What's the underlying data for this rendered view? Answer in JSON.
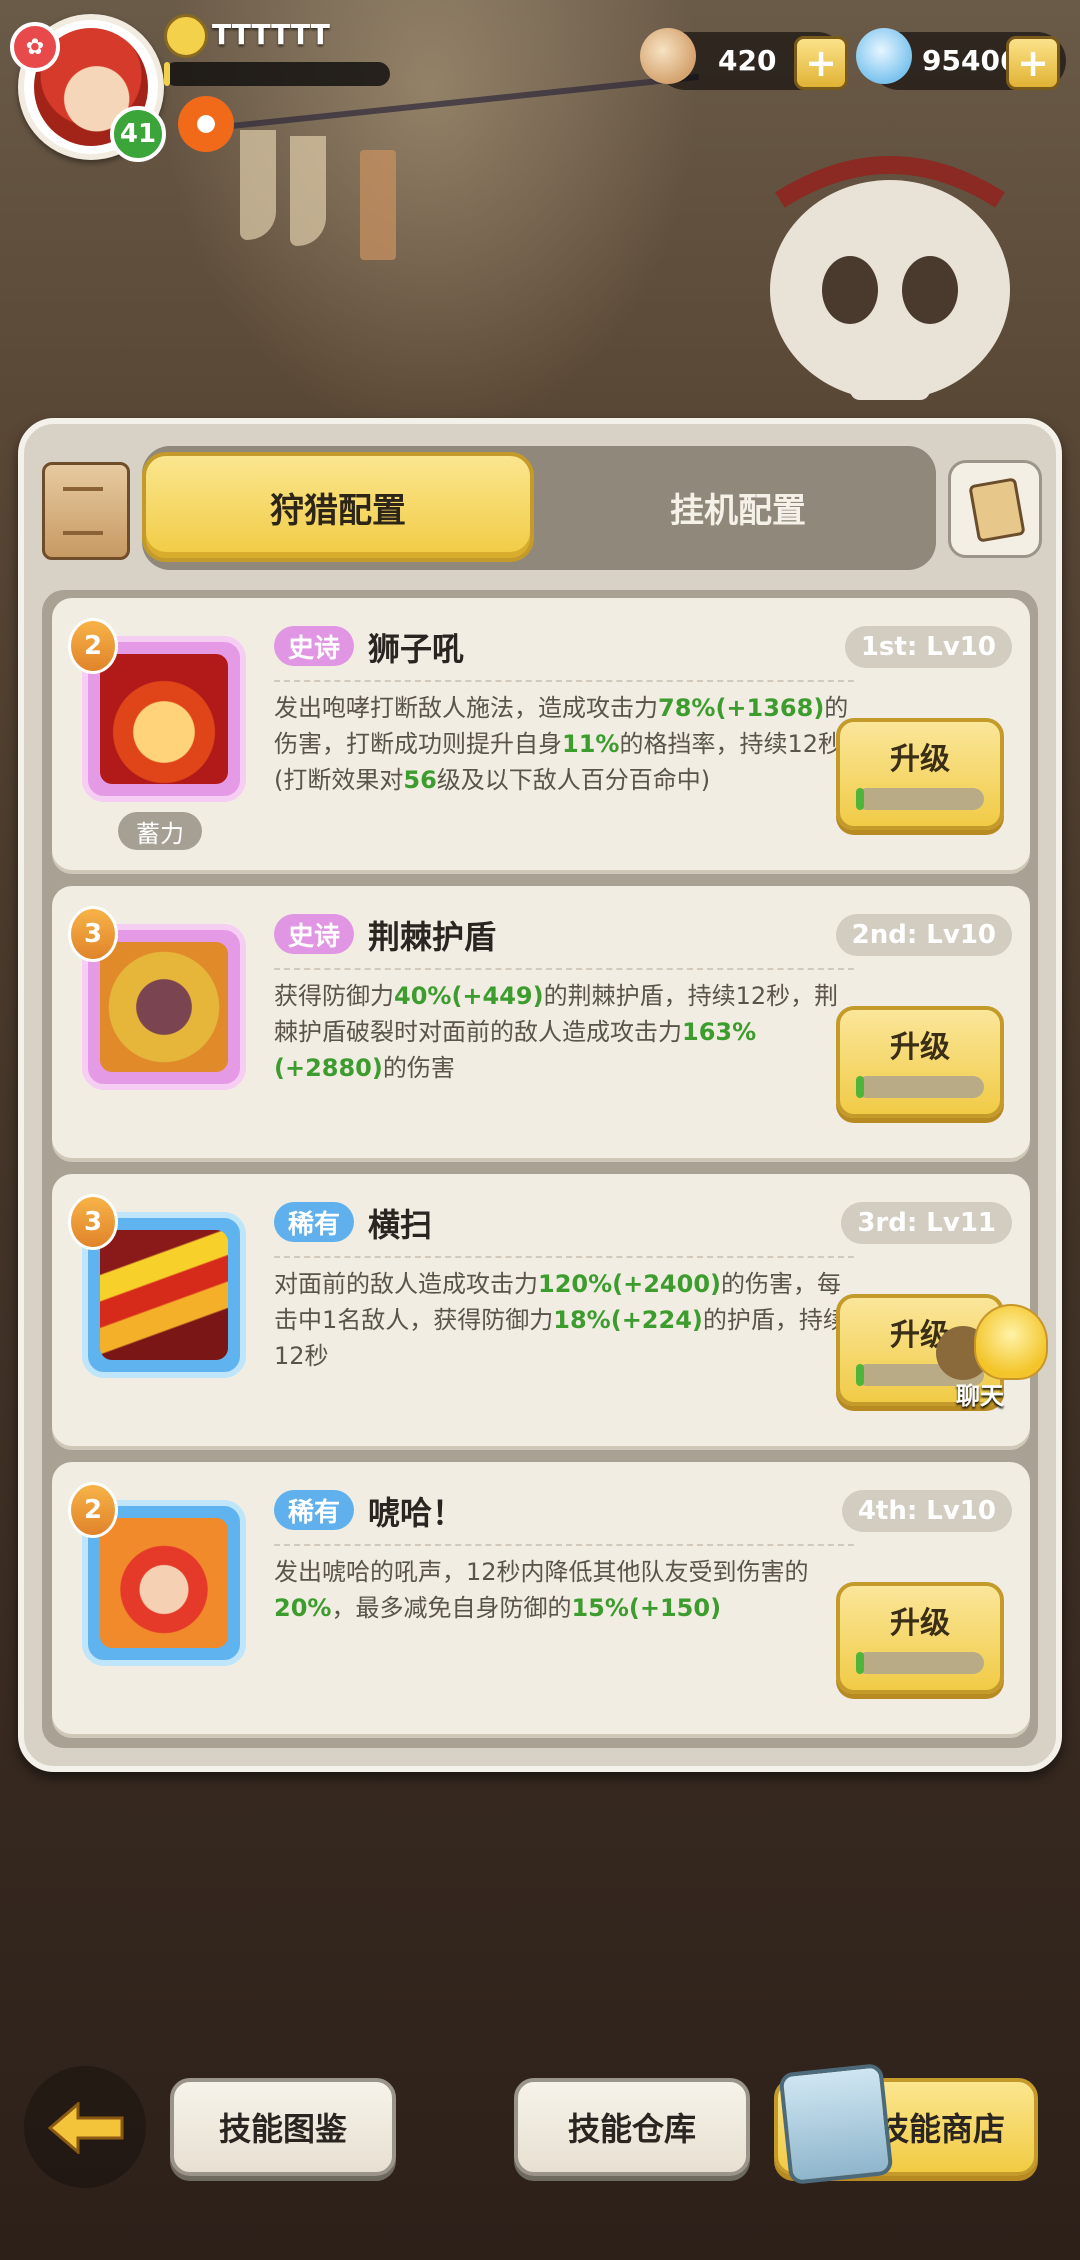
{
  "hud": {
    "player_name": "TTTTTT",
    "level": "41",
    "shell_amount": "420",
    "gem_amount": "95406"
  },
  "tabs": [
    {
      "label": "狩猎配置",
      "active": true
    },
    {
      "label": "挂机配置",
      "active": false
    }
  ],
  "skills": [
    {
      "count": "2",
      "rarity": "史诗",
      "name": "狮子吼",
      "slot": "1st: Lv10",
      "charge_label": "蓄力",
      "desc_parts": [
        "发出咆哮打断敌人施法，造成攻击力",
        "78%(+1368)",
        "的伤害，打断成功则提升自身",
        "11%",
        "的格挡率，持续12秒(打断效果对",
        "56",
        "级及以下敌人百分百命中)"
      ],
      "upgrade_label": "升级"
    },
    {
      "count": "3",
      "rarity": "史诗",
      "name": "荆棘护盾",
      "slot": "2nd: Lv10",
      "desc_parts": [
        "获得防御力",
        "40%(+449)",
        "的荆棘护盾，持续12秒，荆棘护盾破裂时对面前的敌人造成攻击力",
        "163%(+2880)",
        "的伤害"
      ],
      "upgrade_label": "升级"
    },
    {
      "count": "3",
      "rarity": "稀有",
      "name": "横扫",
      "slot": "3rd: Lv11",
      "desc_parts": [
        "对面前的敌人造成攻击力",
        "120%(+2400)",
        "的伤害，每击中1名敌人，获得防御力",
        "18%(+224)",
        "的护盾，持续12秒"
      ],
      "upgrade_label": "升级"
    },
    {
      "count": "2",
      "rarity": "稀有",
      "name": "唬哈！",
      "slot": "4th: Lv10",
      "desc_parts": [
        "发出唬哈的吼声，12秒内降低其他队友受到伤害的",
        "20%",
        "，最多减免自身防御的",
        "15%(+150)"
      ],
      "upgrade_label": "升级"
    }
  ],
  "chat_label": "聊天",
  "bottom": {
    "codex_label": "技能图鉴",
    "storage_label": "技能仓库",
    "shop_label": "技能商店"
  }
}
